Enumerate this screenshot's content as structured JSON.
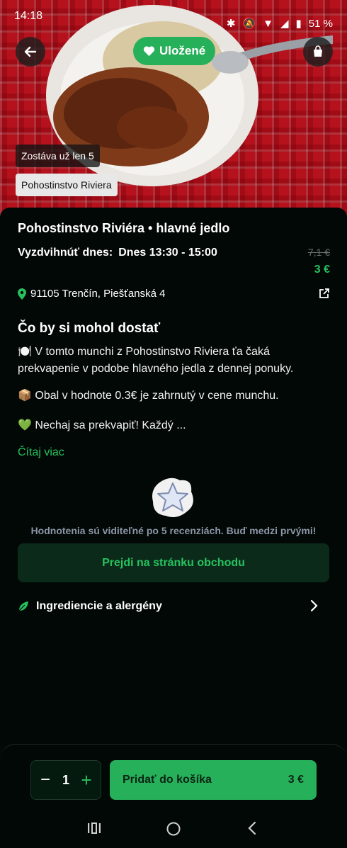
{
  "status": {
    "time": "14:18",
    "battery": "51 %"
  },
  "hero": {
    "saved_label": "Uložené",
    "remaining_label": "Zostáva už len 5",
    "store_tag": "Pohostinstvo Riviera"
  },
  "offer": {
    "title": "Pohostinstvo Riviéra • hlavné jedlo",
    "pickup_label": "Vyzdvihnúť dnes:",
    "pickup_time": "Dnes 13:30 - 15:00",
    "price_old": "7,1 €",
    "price_new": "3 €",
    "address": "91105 Trenčín, Piešťanská 4"
  },
  "description": {
    "heading": "Čo by si mohol dostať",
    "line1": "🍽️ V tomto munchi z Pohostinstvo Riviera ťa čaká prekvapenie v podobe hlavného jedla z dennej ponuky.",
    "line2": "📦 Obal v hodnote 0.3€ je zahrnutý v cene munchu.",
    "line3": "💚 Nechaj sa prekvapiť! Každý ...",
    "read_more": "Čítaj viac"
  },
  "rating": {
    "note": "Hodnotenia sú viditeľné po 5 recenziách. Buď medzi prvými!"
  },
  "store_button": "Prejdi na stránku obchodu",
  "ingredients_label": "Ingrediencie a alergény",
  "cart": {
    "quantity": "1",
    "add_label": "Pridať do košíka",
    "add_price": "3 €"
  },
  "colors": {
    "accent": "#27b05a",
    "accent_text": "#27c25f",
    "background": "#020805"
  }
}
